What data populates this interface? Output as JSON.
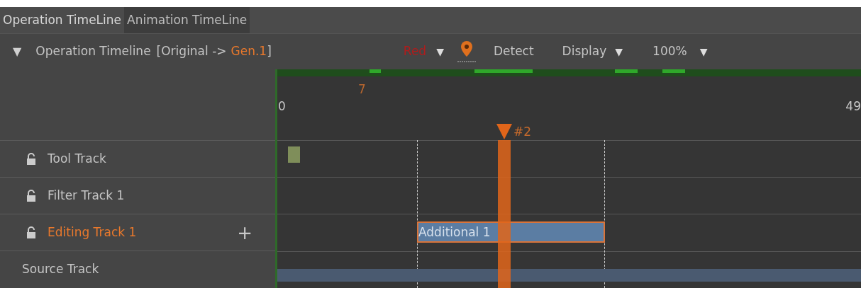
{
  "tabs": [
    {
      "label": "Operation TimeLine",
      "selected": true
    },
    {
      "label": "Animation TimeLine",
      "selected": false
    }
  ],
  "header": {
    "toggle": "▼",
    "title": "Operation Timeline",
    "source": "[Original ->",
    "target": "Gen.1",
    "close": "]",
    "color_menu": "Red",
    "color_caret": "▼",
    "detect": "Detect",
    "display": "Display",
    "display_caret": "▼",
    "zoom": "100%",
    "zoom_caret": "▼"
  },
  "ruler": {
    "start": "0",
    "end": "49",
    "marker": "7",
    "playhead": "#2"
  },
  "tracks": [
    {
      "kind": "locked",
      "name": "Tool Track",
      "selected": false
    },
    {
      "kind": "locked",
      "name": "Filter Track 1",
      "selected": false
    },
    {
      "kind": "locked",
      "name": "Editing Track 1",
      "selected": true,
      "add": "+"
    },
    {
      "kind": "source",
      "name": "Source Track",
      "selected": false
    }
  ],
  "clips": [
    {
      "kind": "tool"
    },
    {
      "kind": "effect",
      "label": "Additional 1"
    },
    {
      "kind": "source"
    }
  ]
}
